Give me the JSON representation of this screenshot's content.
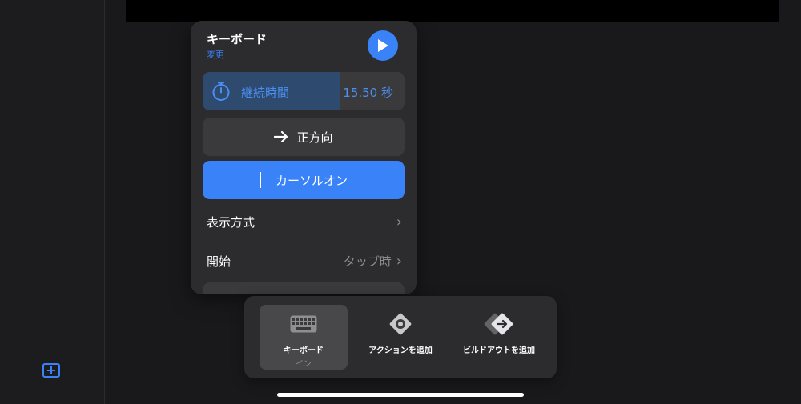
{
  "popover": {
    "title": "キーボード",
    "subtitle": "変更",
    "duration": {
      "label": "継続時間",
      "value": "15.50 秒",
      "fill_fraction": 0.68
    },
    "direction_label": "正方向",
    "cursor_label": "カーソルオン",
    "rows": [
      {
        "label": "表示方式",
        "value": ""
      },
      {
        "label": "開始",
        "value": "タップ時"
      }
    ]
  },
  "toolbar": {
    "items": [
      {
        "label": "キーボード",
        "sublabel": "イン",
        "icon": "keyboard-icon",
        "selected": true
      },
      {
        "label": "アクションを追加",
        "icon": "action-diamond-icon"
      },
      {
        "label": "ビルドアウトを追加",
        "icon": "build-out-icon"
      }
    ]
  },
  "colors": {
    "accent": "#3a82f7",
    "panel": "#2c2c2e",
    "background": "#1b1b1d"
  }
}
